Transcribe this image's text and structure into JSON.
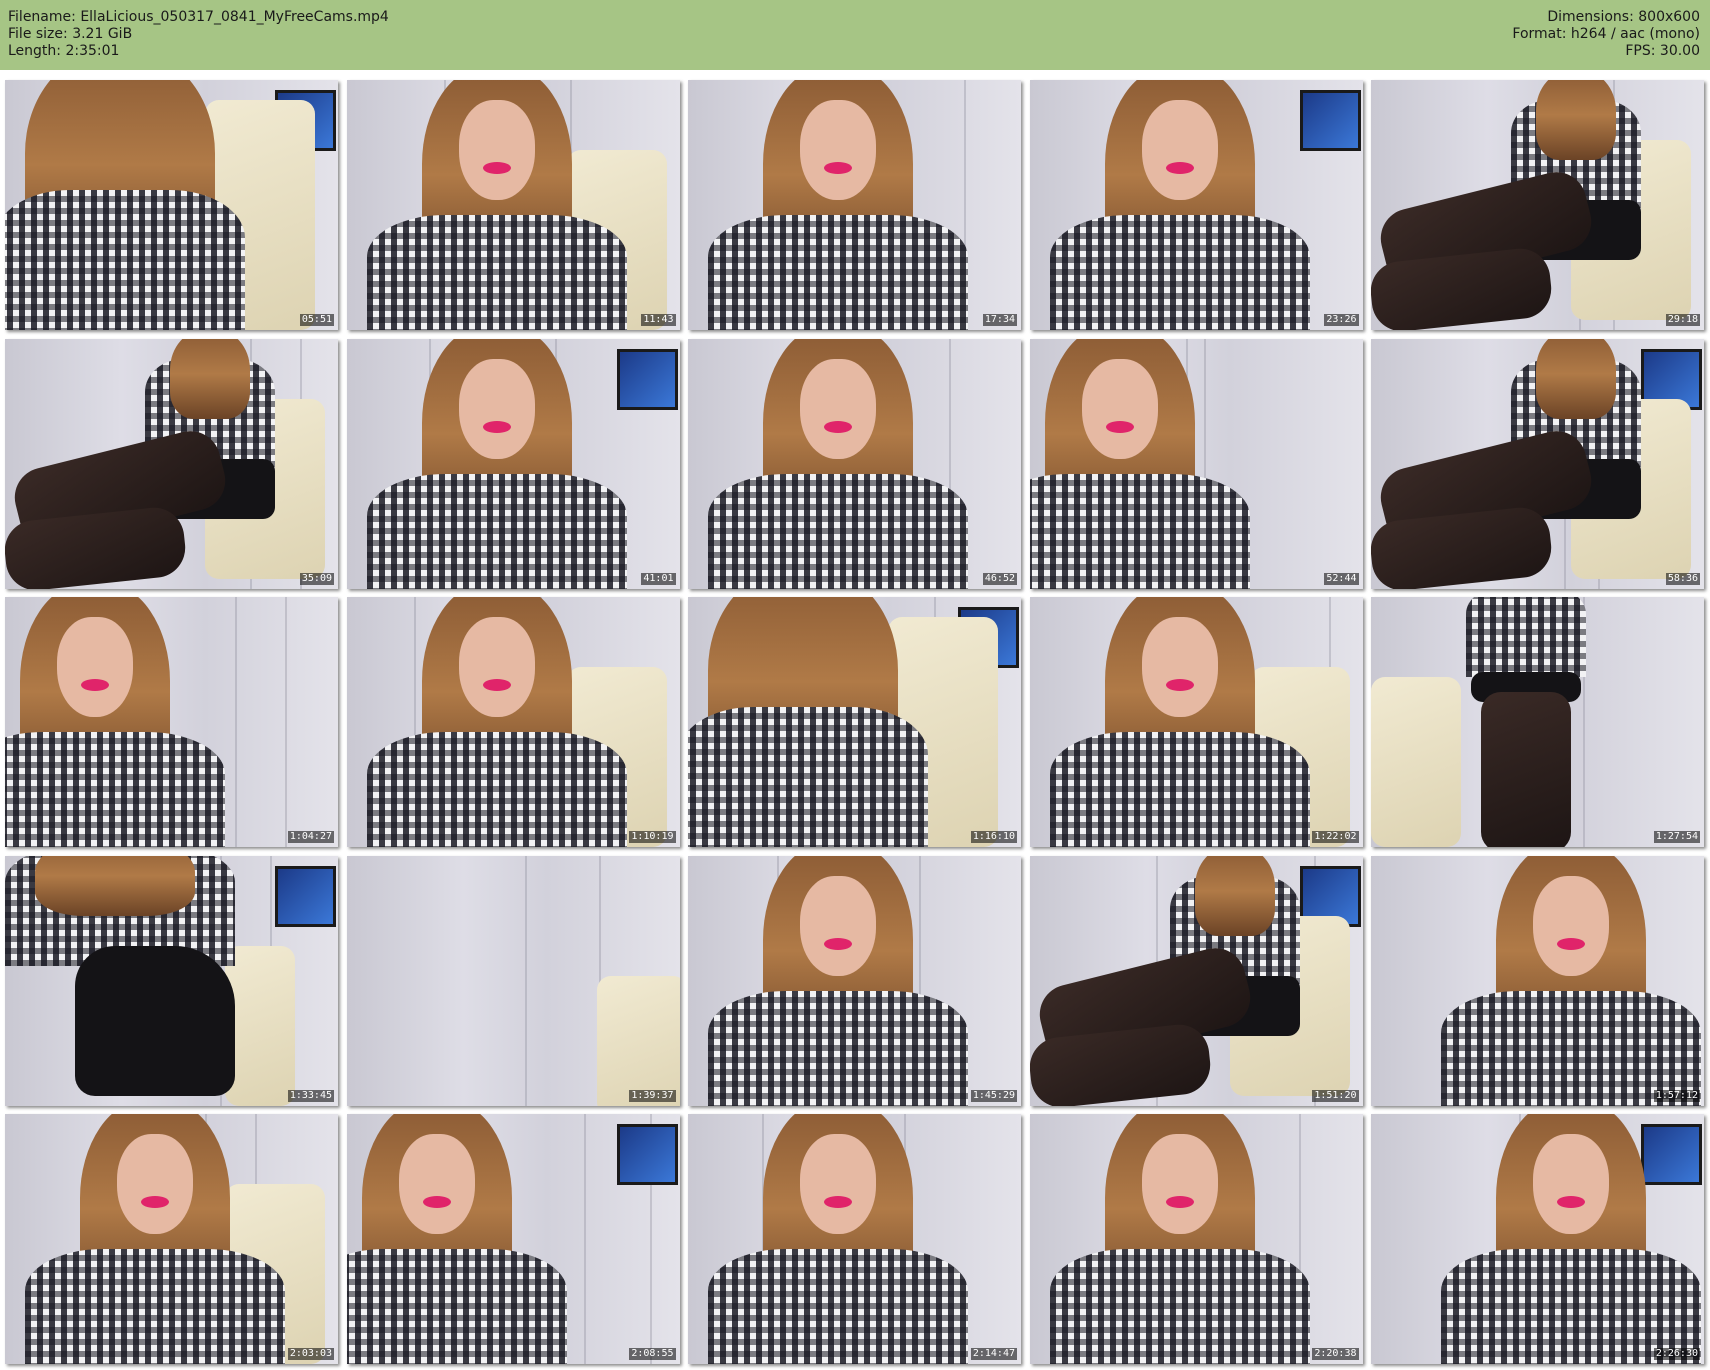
{
  "header": {
    "filename_label": "Filename:",
    "filename": "EllaLicious_050317_0841_MyFreeCams.mp4",
    "filesize_label": "File size:",
    "filesize": "3.21 GiB",
    "length_label": "Length:",
    "length": "2:35:01",
    "dimensions_label": "Dimensions:",
    "dimensions": "800x600",
    "format_label": "Format:",
    "format": "h264 / aac (mono)",
    "fps_label": "FPS:",
    "fps": "30.00"
  },
  "colors": {
    "header_bg": "#a6c585"
  },
  "thumbnails": [
    {
      "timestamp": "05:51",
      "variant": "hair-close"
    },
    {
      "timestamp": "11:43",
      "variant": "face-chair"
    },
    {
      "timestamp": "17:34",
      "variant": "face-center"
    },
    {
      "timestamp": "23:26",
      "variant": "face-center"
    },
    {
      "timestamp": "29:18",
      "variant": "legs"
    },
    {
      "timestamp": "35:09",
      "variant": "legs"
    },
    {
      "timestamp": "41:01",
      "variant": "face-center"
    },
    {
      "timestamp": "46:52",
      "variant": "face-center"
    },
    {
      "timestamp": "52:44",
      "variant": "face-left"
    },
    {
      "timestamp": "58:36",
      "variant": "legs"
    },
    {
      "timestamp": "1:04:27",
      "variant": "face-left"
    },
    {
      "timestamp": "1:10:19",
      "variant": "face-chair"
    },
    {
      "timestamp": "1:16:10",
      "variant": "hair-close"
    },
    {
      "timestamp": "1:22:02",
      "variant": "face-chair"
    },
    {
      "timestamp": "1:27:54",
      "variant": "standing"
    },
    {
      "timestamp": "1:33:45",
      "variant": "skirt"
    },
    {
      "timestamp": "1:39:37",
      "variant": "empty-room"
    },
    {
      "timestamp": "1:45:29",
      "variant": "face-center"
    },
    {
      "timestamp": "1:51:20",
      "variant": "legs"
    },
    {
      "timestamp": "1:57:12",
      "variant": "face-right"
    },
    {
      "timestamp": "2:03:03",
      "variant": "face-chair"
    },
    {
      "timestamp": "2:08:55",
      "variant": "face-left"
    },
    {
      "timestamp": "2:14:47",
      "variant": "face-center"
    },
    {
      "timestamp": "2:20:38",
      "variant": "face-center"
    },
    {
      "timestamp": "2:26:30",
      "variant": "face-right"
    }
  ]
}
